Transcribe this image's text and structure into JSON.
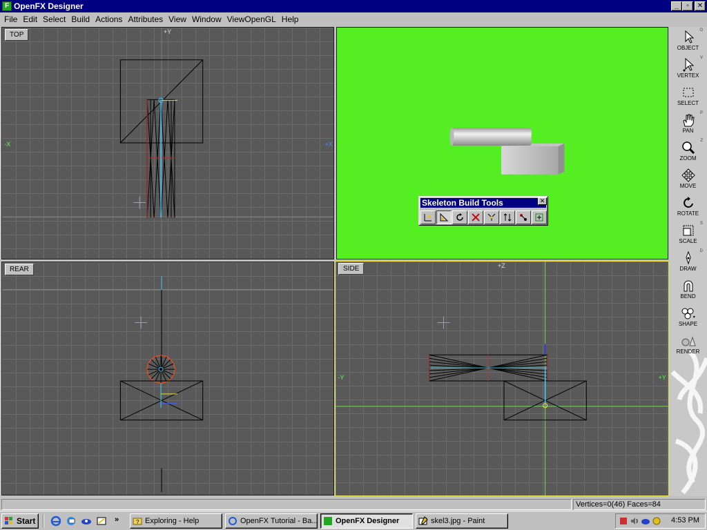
{
  "window": {
    "title": "OpenFX Designer"
  },
  "menu": [
    "File",
    "Edit",
    "Select",
    "Build",
    "Actions",
    "Attributes",
    "View",
    "Window",
    "ViewOpenGL",
    "Help"
  ],
  "viewports": {
    "top": {
      "label": "TOP",
      "axis_top": "+Y",
      "axis_left": "-X",
      "axis_right": "+X"
    },
    "rear": {
      "label": "REAR"
    },
    "side": {
      "label": "SIDE",
      "axis_top": "+Z",
      "axis_left": "-Y",
      "axis_right": "+Y"
    },
    "render3d": {
      "background_color": "#55ee22"
    }
  },
  "skeleton_palette": {
    "title": "Skeleton Build Tools",
    "tools": [
      "add-bone-icon",
      "select-bone-icon",
      "rotate-bone-icon",
      "delete-bone-icon",
      "connect-icon",
      "move-bone-icon",
      "weight-icon",
      "assign-icon"
    ],
    "active_index": 1
  },
  "toolbar": [
    {
      "label": "OBJECT",
      "key": "O",
      "icon": "arrow-cursor-icon"
    },
    {
      "label": "VERTEX",
      "key": "V",
      "icon": "vertex-cursor-icon"
    },
    {
      "label": "SELECT",
      "key": "",
      "icon": "marquee-icon"
    },
    {
      "label": "PAN",
      "key": "P",
      "icon": "hand-icon"
    },
    {
      "label": "ZOOM",
      "key": "Z",
      "icon": "magnifier-icon"
    },
    {
      "label": "MOVE",
      "key": "",
      "icon": "move-icon"
    },
    {
      "label": "ROTATE",
      "key": "",
      "icon": "rotate-icon"
    },
    {
      "label": "SCALE",
      "key": "S",
      "icon": "scale-icon"
    },
    {
      "label": "DRAW",
      "key": "D",
      "icon": "pen-icon"
    },
    {
      "label": "BEND",
      "key": "",
      "icon": "magnet-icon"
    },
    {
      "label": "SHAPE",
      "key": "",
      "icon": "shape-icon"
    },
    {
      "label": "RENDER",
      "key": "",
      "icon": "render-icon"
    }
  ],
  "status": {
    "text": "Vertices=0(46) Faces=84"
  },
  "taskbar": {
    "start": "Start",
    "tasks": [
      {
        "label": "Exploring - Help",
        "active": false
      },
      {
        "label": "OpenFX Tutorial - Ba...",
        "active": false
      },
      {
        "label": "OpenFX Designer",
        "active": true
      },
      {
        "label": "skel3.jpg - Paint",
        "active": false
      }
    ],
    "clock": "4:53 PM"
  }
}
